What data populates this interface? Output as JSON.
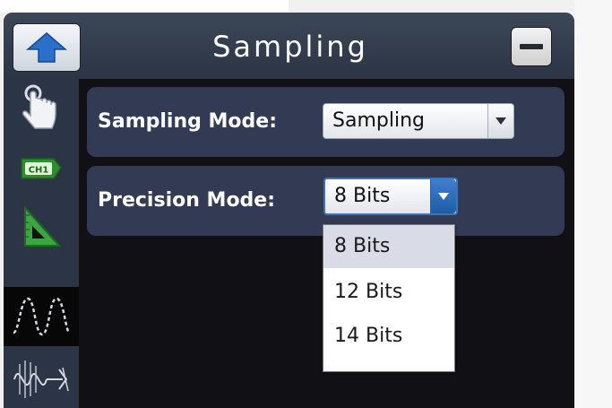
{
  "window": {
    "title": "Sampling"
  },
  "sidebar": {
    "items": [
      {
        "icon": "touch-hand-icon",
        "active": false
      },
      {
        "icon": "channel-icon",
        "label": "CH1",
        "active": false
      },
      {
        "icon": "ruler-triangle-icon",
        "active": false
      },
      {
        "icon": "sine-wave-icon",
        "active": true
      },
      {
        "icon": "fft-signal-icon",
        "active": false
      }
    ]
  },
  "settings": {
    "sampling_mode": {
      "label": "Sampling Mode:",
      "value": "Sampling"
    },
    "precision_mode": {
      "label": "Precision Mode:",
      "value": "8 Bits",
      "options": [
        "8 Bits",
        "12 Bits",
        "14 Bits"
      ]
    }
  },
  "colors": {
    "titlebar": "#333d4e",
    "row_background": "#323a54",
    "panel_background": "#101015",
    "accent": "#2f6fc0"
  }
}
